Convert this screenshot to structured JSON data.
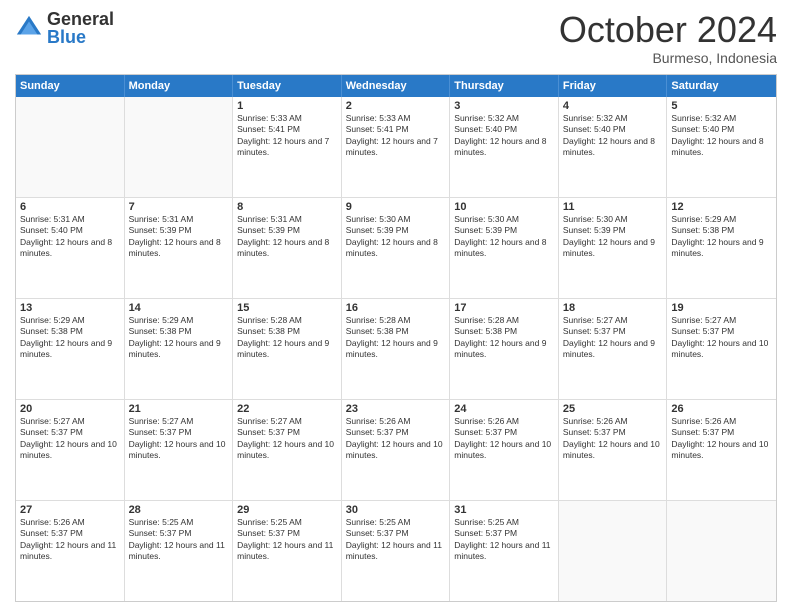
{
  "logo": {
    "general": "General",
    "blue": "Blue"
  },
  "header": {
    "month": "October 2024",
    "location": "Burmeso, Indonesia"
  },
  "weekdays": [
    "Sunday",
    "Monday",
    "Tuesday",
    "Wednesday",
    "Thursday",
    "Friday",
    "Saturday"
  ],
  "rows": [
    [
      {
        "day": "",
        "sunrise": "",
        "sunset": "",
        "daylight": ""
      },
      {
        "day": "",
        "sunrise": "",
        "sunset": "",
        "daylight": ""
      },
      {
        "day": "1",
        "sunrise": "Sunrise: 5:33 AM",
        "sunset": "Sunset: 5:41 PM",
        "daylight": "Daylight: 12 hours and 7 minutes."
      },
      {
        "day": "2",
        "sunrise": "Sunrise: 5:33 AM",
        "sunset": "Sunset: 5:41 PM",
        "daylight": "Daylight: 12 hours and 7 minutes."
      },
      {
        "day": "3",
        "sunrise": "Sunrise: 5:32 AM",
        "sunset": "Sunset: 5:40 PM",
        "daylight": "Daylight: 12 hours and 8 minutes."
      },
      {
        "day": "4",
        "sunrise": "Sunrise: 5:32 AM",
        "sunset": "Sunset: 5:40 PM",
        "daylight": "Daylight: 12 hours and 8 minutes."
      },
      {
        "day": "5",
        "sunrise": "Sunrise: 5:32 AM",
        "sunset": "Sunset: 5:40 PM",
        "daylight": "Daylight: 12 hours and 8 minutes."
      }
    ],
    [
      {
        "day": "6",
        "sunrise": "Sunrise: 5:31 AM",
        "sunset": "Sunset: 5:40 PM",
        "daylight": "Daylight: 12 hours and 8 minutes."
      },
      {
        "day": "7",
        "sunrise": "Sunrise: 5:31 AM",
        "sunset": "Sunset: 5:39 PM",
        "daylight": "Daylight: 12 hours and 8 minutes."
      },
      {
        "day": "8",
        "sunrise": "Sunrise: 5:31 AM",
        "sunset": "Sunset: 5:39 PM",
        "daylight": "Daylight: 12 hours and 8 minutes."
      },
      {
        "day": "9",
        "sunrise": "Sunrise: 5:30 AM",
        "sunset": "Sunset: 5:39 PM",
        "daylight": "Daylight: 12 hours and 8 minutes."
      },
      {
        "day": "10",
        "sunrise": "Sunrise: 5:30 AM",
        "sunset": "Sunset: 5:39 PM",
        "daylight": "Daylight: 12 hours and 8 minutes."
      },
      {
        "day": "11",
        "sunrise": "Sunrise: 5:30 AM",
        "sunset": "Sunset: 5:39 PM",
        "daylight": "Daylight: 12 hours and 9 minutes."
      },
      {
        "day": "12",
        "sunrise": "Sunrise: 5:29 AM",
        "sunset": "Sunset: 5:38 PM",
        "daylight": "Daylight: 12 hours and 9 minutes."
      }
    ],
    [
      {
        "day": "13",
        "sunrise": "Sunrise: 5:29 AM",
        "sunset": "Sunset: 5:38 PM",
        "daylight": "Daylight: 12 hours and 9 minutes."
      },
      {
        "day": "14",
        "sunrise": "Sunrise: 5:29 AM",
        "sunset": "Sunset: 5:38 PM",
        "daylight": "Daylight: 12 hours and 9 minutes."
      },
      {
        "day": "15",
        "sunrise": "Sunrise: 5:28 AM",
        "sunset": "Sunset: 5:38 PM",
        "daylight": "Daylight: 12 hours and 9 minutes."
      },
      {
        "day": "16",
        "sunrise": "Sunrise: 5:28 AM",
        "sunset": "Sunset: 5:38 PM",
        "daylight": "Daylight: 12 hours and 9 minutes."
      },
      {
        "day": "17",
        "sunrise": "Sunrise: 5:28 AM",
        "sunset": "Sunset: 5:38 PM",
        "daylight": "Daylight: 12 hours and 9 minutes."
      },
      {
        "day": "18",
        "sunrise": "Sunrise: 5:27 AM",
        "sunset": "Sunset: 5:37 PM",
        "daylight": "Daylight: 12 hours and 9 minutes."
      },
      {
        "day": "19",
        "sunrise": "Sunrise: 5:27 AM",
        "sunset": "Sunset: 5:37 PM",
        "daylight": "Daylight: 12 hours and 10 minutes."
      }
    ],
    [
      {
        "day": "20",
        "sunrise": "Sunrise: 5:27 AM",
        "sunset": "Sunset: 5:37 PM",
        "daylight": "Daylight: 12 hours and 10 minutes."
      },
      {
        "day": "21",
        "sunrise": "Sunrise: 5:27 AM",
        "sunset": "Sunset: 5:37 PM",
        "daylight": "Daylight: 12 hours and 10 minutes."
      },
      {
        "day": "22",
        "sunrise": "Sunrise: 5:27 AM",
        "sunset": "Sunset: 5:37 PM",
        "daylight": "Daylight: 12 hours and 10 minutes."
      },
      {
        "day": "23",
        "sunrise": "Sunrise: 5:26 AM",
        "sunset": "Sunset: 5:37 PM",
        "daylight": "Daylight: 12 hours and 10 minutes."
      },
      {
        "day": "24",
        "sunrise": "Sunrise: 5:26 AM",
        "sunset": "Sunset: 5:37 PM",
        "daylight": "Daylight: 12 hours and 10 minutes."
      },
      {
        "day": "25",
        "sunrise": "Sunrise: 5:26 AM",
        "sunset": "Sunset: 5:37 PM",
        "daylight": "Daylight: 12 hours and 10 minutes."
      },
      {
        "day": "26",
        "sunrise": "Sunrise: 5:26 AM",
        "sunset": "Sunset: 5:37 PM",
        "daylight": "Daylight: 12 hours and 10 minutes."
      }
    ],
    [
      {
        "day": "27",
        "sunrise": "Sunrise: 5:26 AM",
        "sunset": "Sunset: 5:37 PM",
        "daylight": "Daylight: 12 hours and 11 minutes."
      },
      {
        "day": "28",
        "sunrise": "Sunrise: 5:25 AM",
        "sunset": "Sunset: 5:37 PM",
        "daylight": "Daylight: 12 hours and 11 minutes."
      },
      {
        "day": "29",
        "sunrise": "Sunrise: 5:25 AM",
        "sunset": "Sunset: 5:37 PM",
        "daylight": "Daylight: 12 hours and 11 minutes."
      },
      {
        "day": "30",
        "sunrise": "Sunrise: 5:25 AM",
        "sunset": "Sunset: 5:37 PM",
        "daylight": "Daylight: 12 hours and 11 minutes."
      },
      {
        "day": "31",
        "sunrise": "Sunrise: 5:25 AM",
        "sunset": "Sunset: 5:37 PM",
        "daylight": "Daylight: 12 hours and 11 minutes."
      },
      {
        "day": "",
        "sunrise": "",
        "sunset": "",
        "daylight": ""
      },
      {
        "day": "",
        "sunrise": "",
        "sunset": "",
        "daylight": ""
      }
    ]
  ]
}
